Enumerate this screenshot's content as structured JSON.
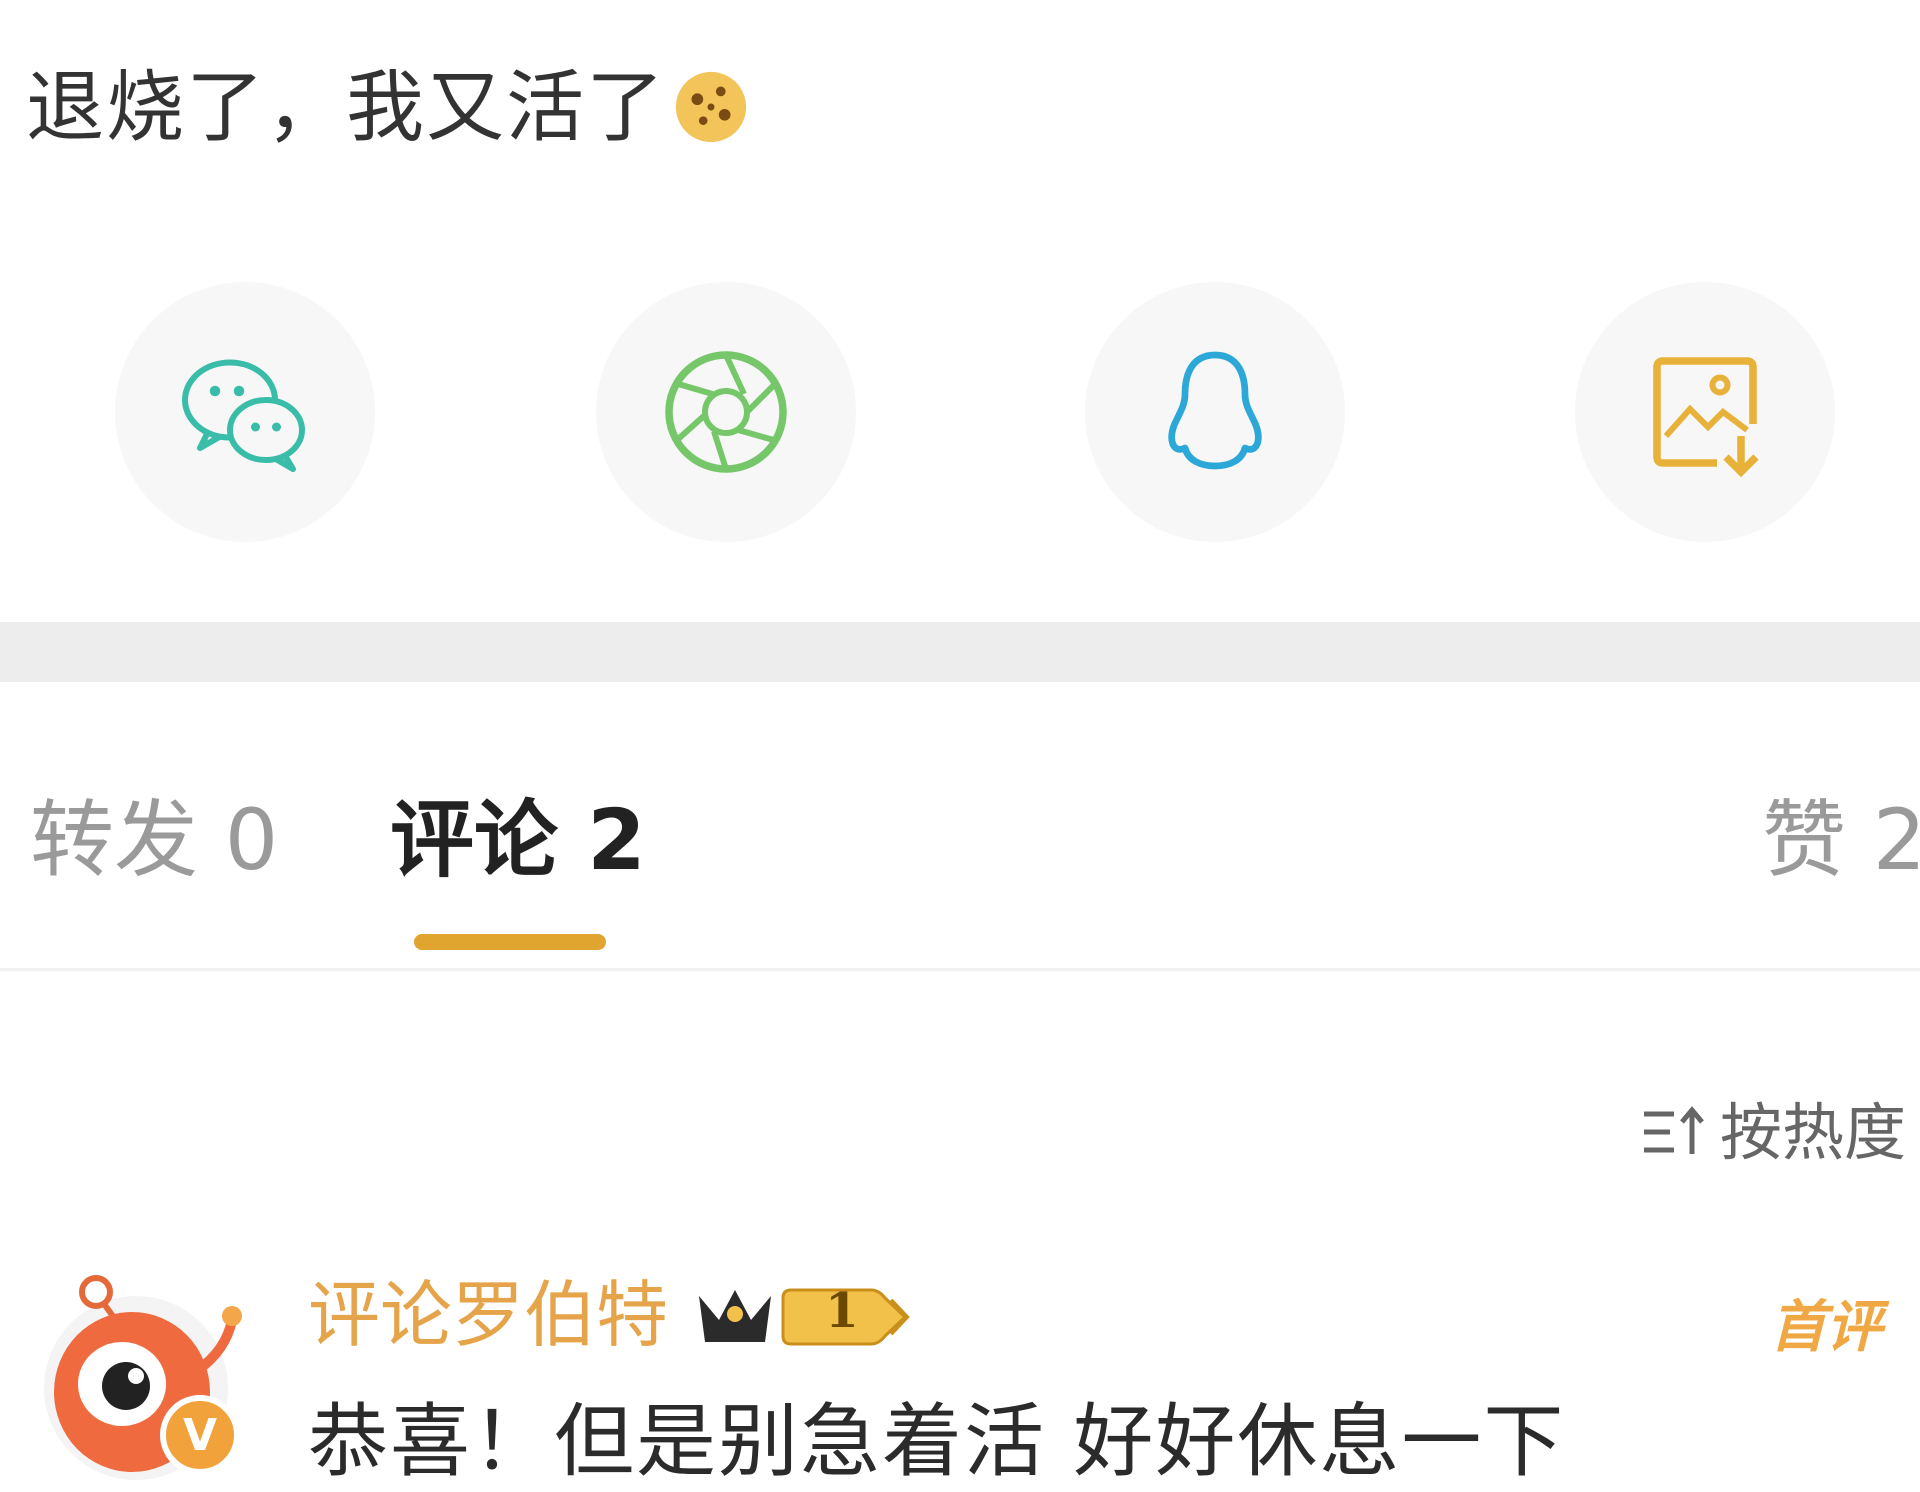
{
  "post": {
    "text": "退烧了，我又活了",
    "emoji": "cookie-face-emoji"
  },
  "share": {
    "items": [
      {
        "name": "wechat",
        "icon": "wechat-icon",
        "color": "#39bda8"
      },
      {
        "name": "moments",
        "icon": "aperture-icon",
        "color": "#76c76a"
      },
      {
        "name": "qq",
        "icon": "penguin-icon",
        "color": "#2ba8d8"
      },
      {
        "name": "save-image",
        "icon": "save-image-icon",
        "color": "#e8b13a"
      }
    ]
  },
  "tabs": {
    "repost": "转发 0",
    "comment": "评论 2",
    "like": "赞 2",
    "accent": "#e0a52e"
  },
  "sort": {
    "label": "按热度",
    "icon": "sort-icon"
  },
  "comment": {
    "username": "评论罗伯特",
    "level": "1",
    "badge": "首评",
    "text": "恭喜！但是别急着活 好好休息一下",
    "username_color": "#e6a44a"
  }
}
